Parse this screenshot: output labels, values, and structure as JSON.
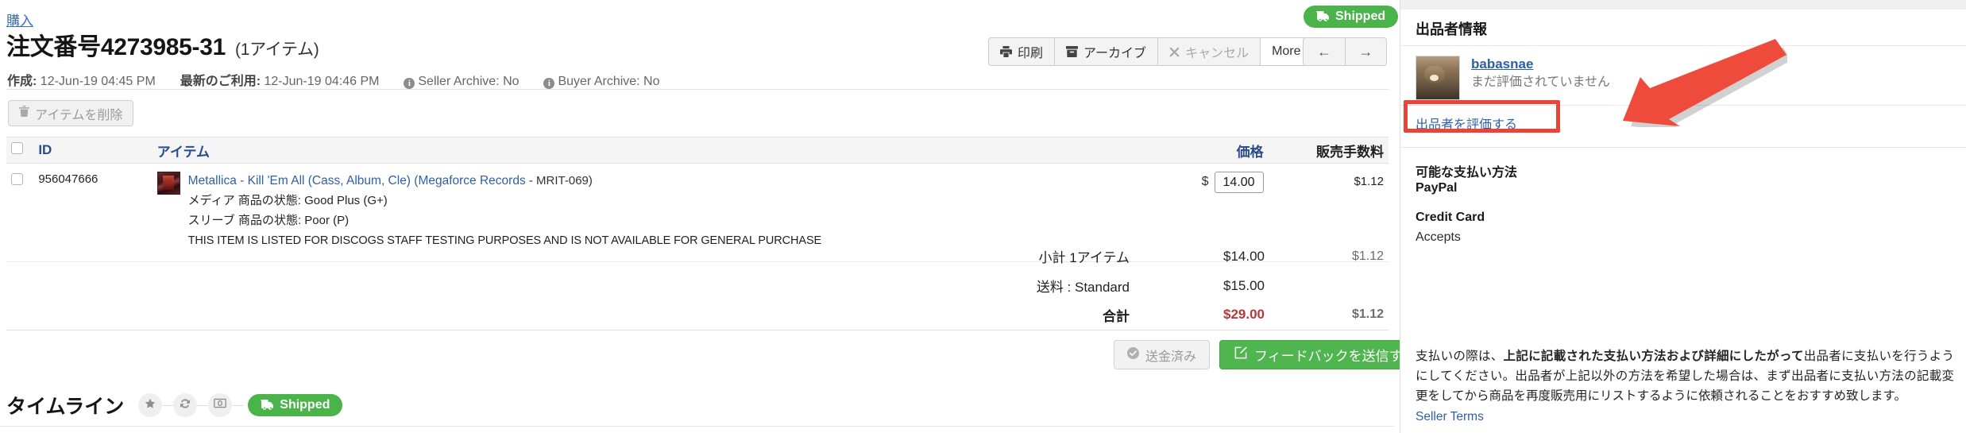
{
  "breadcrumb": "購入",
  "order": {
    "title_prefix": "注文番号",
    "order_number": "4273985-31",
    "item_count_label": "(1アイテム)",
    "created_label": "作成:",
    "created_value": "12-Jun-19 04:45 PM",
    "updated_label": "最新のご利用:",
    "updated_value": "12-Jun-19 04:46 PM",
    "seller_archive": "Seller Archive: No",
    "buyer_archive": "Buyer Archive: No",
    "status_badge": "Shipped"
  },
  "toolbar": {
    "print": "印刷",
    "archive": "アーカイブ",
    "cancel": "キャンセル",
    "more": "More",
    "prev": "←",
    "next": "→"
  },
  "actions": {
    "delete_item": "アイテムを削除",
    "payment_received": "送金済み",
    "leave_feedback": "フィードバックを送信する"
  },
  "table": {
    "headers": {
      "id": "ID",
      "item": "アイテム",
      "price": "価格",
      "fee": "販売手数料"
    },
    "rows": [
      {
        "id": "956047666",
        "title_link": "Metallica - Kill 'Em All (Cass, Album, Cle) (Megaforce Records",
        "title_tail": "- MRIT-069)",
        "media_condition": "メディア 商品の状態: Good Plus (G+)",
        "sleeve_condition": "スリーブ 商品の状態: Poor (P)",
        "note": "THIS ITEM IS LISTED FOR DISCOGS STAFF TESTING PURPOSES AND IS NOT AVAILABLE FOR GENERAL PURCHASE",
        "currency": "$",
        "price": "14.00",
        "fee": "$1.12"
      }
    ],
    "totals": [
      {
        "label": "小計 1アイテム",
        "amount": "$14.00",
        "fee": "$1.12"
      },
      {
        "label": "送料 : Standard",
        "amount": "$15.00",
        "fee": ""
      },
      {
        "label": "合計",
        "amount": "$29.00",
        "fee": "$1.12"
      }
    ]
  },
  "timeline": {
    "title": "タイムライン",
    "status_badge": "Shipped"
  },
  "sidebar": {
    "heading": "出品者情報",
    "seller_name": "babasnae",
    "seller_rating": "まだ評価されていません",
    "rate_seller": "出品者を評価する",
    "payment_heading": "可能な支払い方法",
    "paypal": "PayPal",
    "credit_card": "Credit Card",
    "accepts": "Accepts",
    "disclaimer_a": "支払いの際は、",
    "disclaimer_b": "上記に記載された支払い方法および詳細にしたがって",
    "disclaimer_c": "出品者に支払いを行うようにしてください。出品者が上記以外の方法を希望した場合は、まず出品者に支払い方法の記載変更をしてから商品を再度販売用にリストするように依頼されることをおすすめ致します。",
    "seller_terms": "Seller Terms"
  },
  "colors": {
    "accent_green": "#4ab34a",
    "link_blue": "#2f5fa8",
    "total_red": "#b33a3a",
    "annotation_red": "#e8443a"
  }
}
